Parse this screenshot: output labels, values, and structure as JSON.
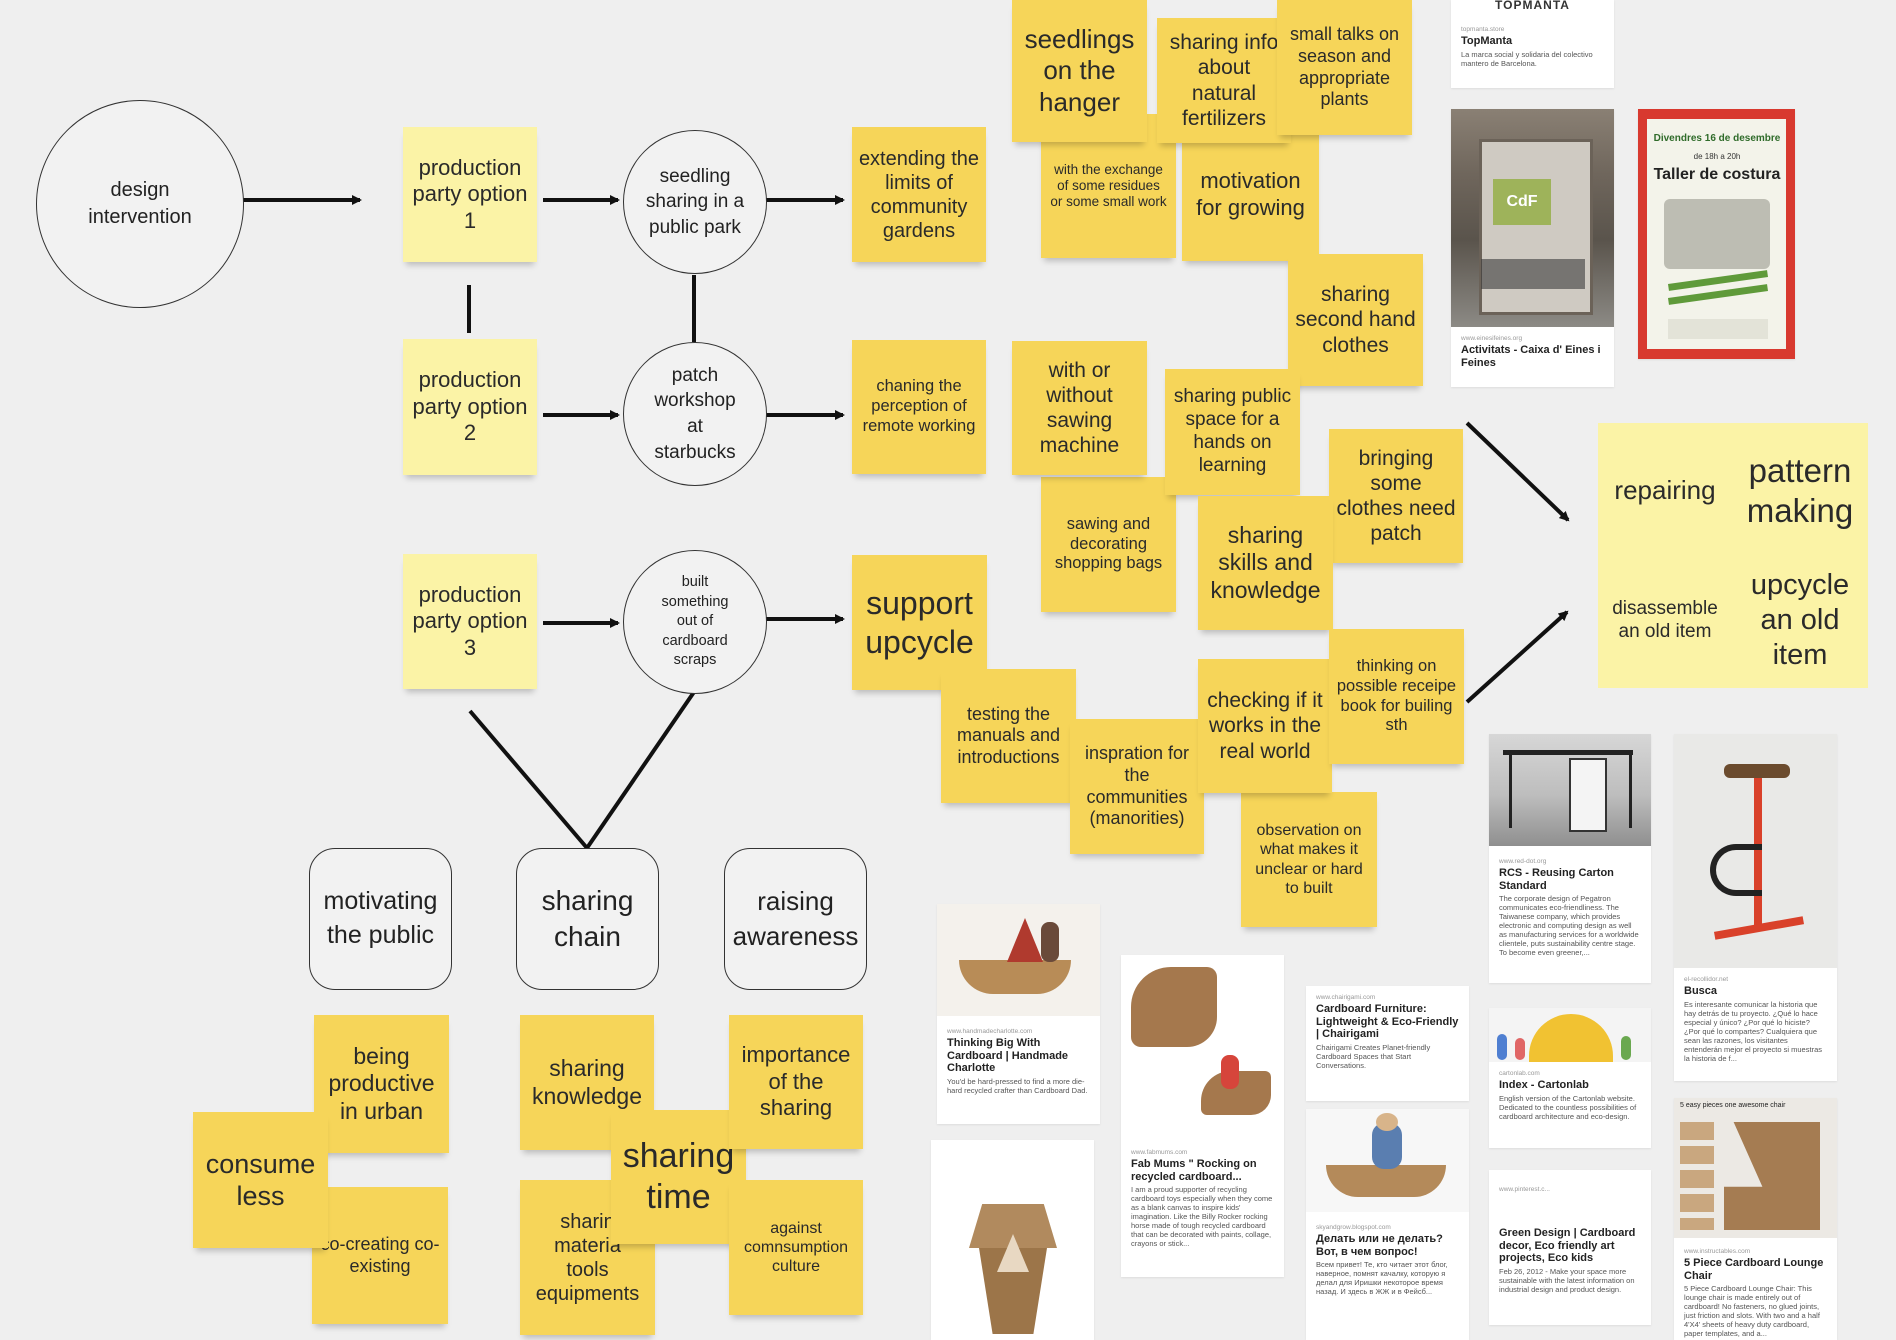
{
  "diagram": {
    "intervention": "design intervention",
    "option1": "production party option 1",
    "option2": "production party option 2",
    "option3": "production party option 3",
    "seedling": "seedling sharing in a public park",
    "patch": "patch workshop at starbucks",
    "cardboard": "built something out of cardboard scraps",
    "extending": "extending the limits of community gardens",
    "changing": "chaning the perception of remote working",
    "support": "support upcycle",
    "motivating": "motivating the public",
    "sharing_chain": "sharing chain",
    "raising": "raising awareness"
  },
  "notes": {
    "seedlings": "seedlings on the hanger",
    "exchange": "with the exchange of some residues or some small work",
    "sharing_info": "sharing info about natural fertilizers",
    "small_talks": "small talks on season and appropriate plants",
    "motivation": "motivation for growing",
    "second_hand": "sharing second hand clothes",
    "with_without": "with or without sawing machine",
    "public_space": "sharing public space for a hands on learning",
    "bringing": "bringing some clothes need patch",
    "sawing": "sawing and decorating shopping bags",
    "skills": "sharing skills and knowledge",
    "testing": "testing the manuals and introductions",
    "checking": "checking if it works in the real world",
    "thinking": "thinking on possible receipe book for builing sth",
    "inspiration": "inspration for the communities (manorities)",
    "observation": "observation on what makes it unclear or hard to built",
    "repairing": "repairing",
    "pattern": "pattern making",
    "disassemble": "disassemble an old item",
    "upcycle_old": "upcycle an old item",
    "productive": "being productive in urban",
    "consume": "consume less",
    "cocreating": "co-creating co-existing",
    "sharing_knowledge": "sharing knowledge",
    "sharing_time": "sharing time",
    "sharing_materials": "sharin materia tools equipments",
    "importance": "importance of the sharing",
    "against": "against comnsumption culture"
  },
  "cards": {
    "topmanta": {
      "logo": "TOPMANTA",
      "src": "topmanta.store",
      "title": "TopManta",
      "desc": "La marca social y solidaria del colectivo mantero de Barcelona."
    },
    "caixa": {
      "photo_text": "CdF",
      "src": "www.einesifeines.org",
      "title": "Activitats - Caixa d' Eines i Feines"
    },
    "poster": {
      "date": "Divendres 16 de desembre",
      "time": "de 18h a 20h",
      "headline": "Taller de costura"
    },
    "rcs": {
      "src": "www.red-dot.org",
      "title": "RCS - Reusing Carton Standard",
      "desc": "The corporate design of Pegatron communicates eco-friendliness. The Taiwanese company, which provides electronic and computing design as well as manufacturing services for a worldwide clientele, puts sustainability centre stage. To become even greener,..."
    },
    "busca": {
      "src": "el-recollidor.net",
      "title": "Busca",
      "desc": "Es interesante comunicar la historia que hay detrás de tu proyecto. ¿Qué lo hace especial y único? ¿Por qué lo hiciste? ¿Por qué lo compartes? Cualquiera que sean las razones, los visitantes entenderán mejor el proyecto si muestras la historia de f..."
    },
    "thinking_big": {
      "src": "www.handmadecharlotte.com",
      "title": "Thinking Big With Cardboard | Handmade Charlotte",
      "desc": "You'd be hard-pressed to find a more die-hard recycled crafter than Cardboard Dad."
    },
    "fab_mums": {
      "src": "www.fabmums.com",
      "title": "Fab Mums \" Rocking on recycled cardboard...",
      "desc": "I am a proud supporter of recycling cardboard toys especially when they come as a blank canvas to inspire kids' imagination. Like the Billy Rocker rocking horse made of tough recycled cardboard that can be decorated with paints, collage, crayons or stick..."
    },
    "chairigami": {
      "src": "www.chairigami.com",
      "title": "Cardboard Furniture: Lightweight & Eco-Friendly | Chairigami",
      "desc": "Chairigami Creates Planet-friendly Cardboard Spaces that Start Conversations."
    },
    "russian": {
      "src": "skyandgrow.blogspot.com",
      "title": "Делать или не делать? Вот, в чем вопрос!",
      "desc": "Всем привет! Те, кто читает этот блог, наверное, помнят качалку, которую я делал для Иришки некоторое время назад. И здесь в ЖЖ и в Фейсб..."
    },
    "cartonlab": {
      "src": "cartonlab.com",
      "title": "Index - Cartonlab",
      "desc": "English version of the Cartonlab website. Dedicated to the countless possibilities of cardboard architecture and eco-design."
    },
    "green": {
      "src": "www.pinterest.c...",
      "title": "Green Design | Cardboard decor, Eco friendly art projects, Eco kids",
      "desc": "Feb 26, 2012 - Make your space more sustainable with the latest information on industrial design and product design."
    },
    "lounge": {
      "photo_caption": "5 easy pieces one awesome chair",
      "src": "www.instructables.com",
      "title": "5 Piece Cardboard Lounge Chair",
      "desc": "5 Piece Cardboard Lounge Chair: This lounge chair is made entirely out of cardboard! No fasteners, no glued joints, just friction and slots. With two and a half 4'X4' sheets of heavy duty cardboard, paper templates, and a..."
    }
  }
}
